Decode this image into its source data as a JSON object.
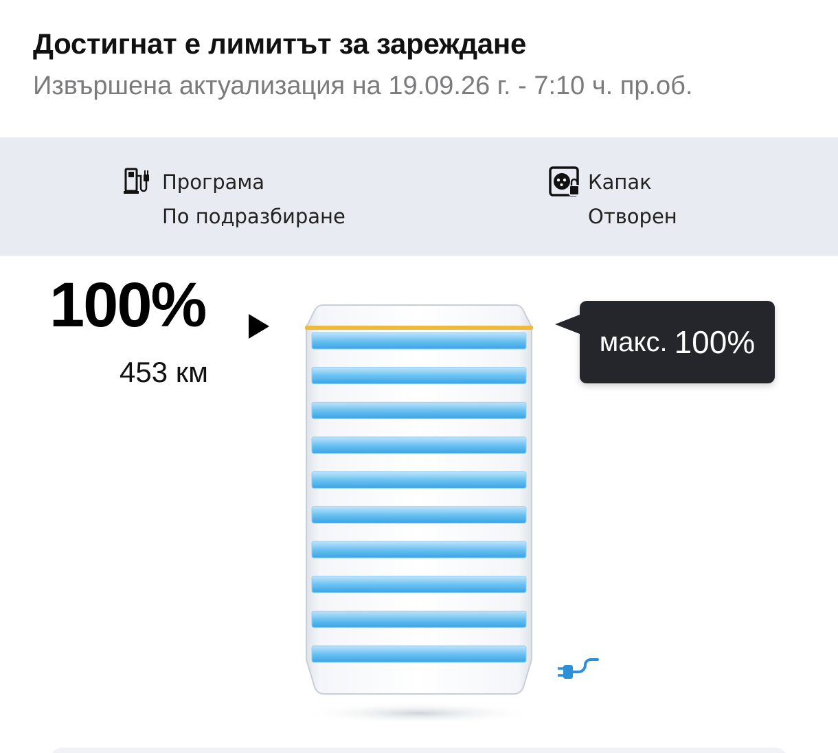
{
  "header": {
    "title": "Достигнат е лимитът за зареждане",
    "subtitle": "Извършена актуализация на 19.09.26 г. - 7:10 ч. пр.об."
  },
  "info": {
    "program": {
      "label": "Програма",
      "value": "По подразбиране",
      "icon": "charging-station-icon"
    },
    "flap": {
      "label": "Капак",
      "value": "Отворен",
      "icon": "charging-flap-unlocked-icon"
    }
  },
  "battery": {
    "soc_text": "100%",
    "range_text": "453 км",
    "level_percent": 100,
    "charge_limit_percent": 100,
    "segments": 10,
    "fill_color": "#5ab8f0",
    "limit_color": "#f0b93a"
  },
  "limit": {
    "label": "макс.",
    "value": "100%"
  },
  "status": {
    "plug_icon": "plug-connected-icon",
    "plug_color": "#2d8fd8"
  }
}
